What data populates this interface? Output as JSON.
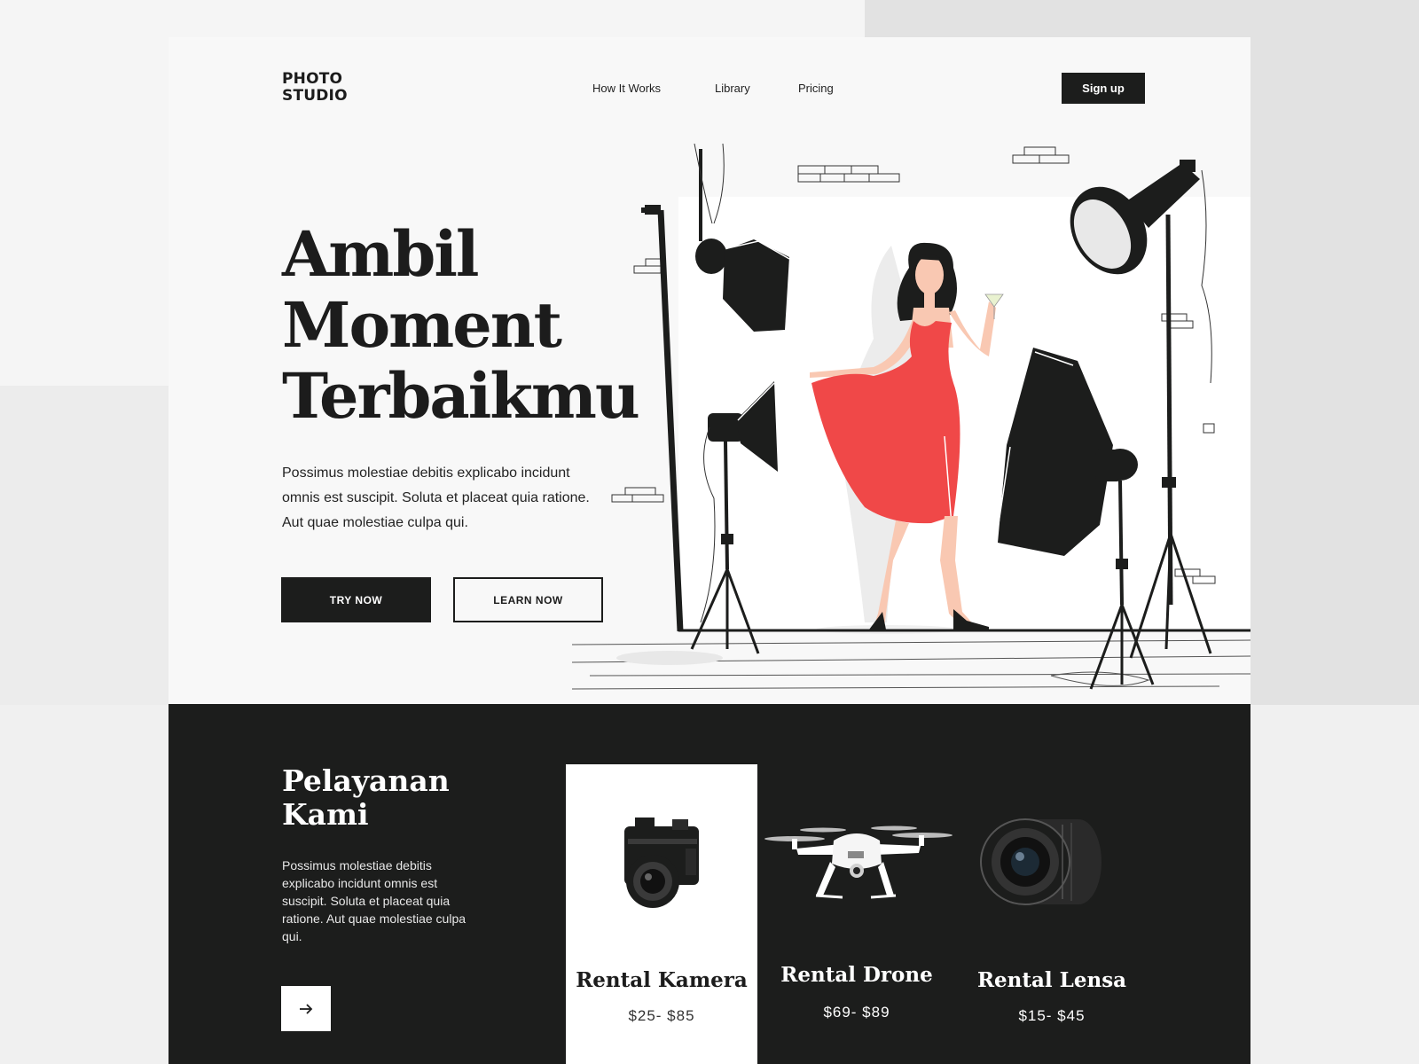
{
  "header": {
    "logo_line1": "PHOTO",
    "logo_line2": "STUDIO",
    "nav": [
      "How It Works",
      "Library",
      "Pricing"
    ],
    "signup_label": "Sign up"
  },
  "hero": {
    "title_lines": [
      "Ambil",
      "Moment",
      "Terbaikmu"
    ],
    "description": "Possimus molestiae debitis explicabo incidunt omnis est suscipit. Soluta et placeat quia ratione. Aut quae molestiae culpa qui.",
    "try_label": "TRY NOW",
    "learn_label": "LEARN NOW"
  },
  "services": {
    "title_lines": [
      "Pelayanan",
      "Kami"
    ],
    "description": "Possimus molestiae debitis explicabo incidunt omnis est suscipit. Soluta et placeat quia ratione. Aut quae molestiae culpa qui.",
    "arrow_icon": "arrow-right-icon",
    "cards": [
      {
        "name": "Rental Kamera",
        "price": "$25- $85",
        "icon": "camera-icon"
      },
      {
        "name": "Rental Drone",
        "price": "$69- $89",
        "icon": "drone-icon"
      },
      {
        "name": "Rental Lensa",
        "price": "$15- $45",
        "icon": "lens-icon"
      }
    ]
  },
  "colors": {
    "dark": "#1c1d1c",
    "dress": "#f04848",
    "page": "#f8f8f8"
  }
}
